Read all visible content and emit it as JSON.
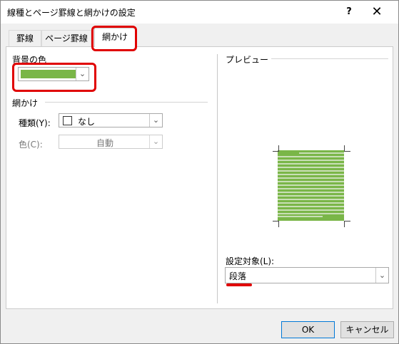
{
  "window": {
    "title": "線種とページ罫線と網かけの設定",
    "help_label": "?",
    "close_label": "✕"
  },
  "tabs": [
    {
      "label": "罫線"
    },
    {
      "label": "ページ罫線"
    },
    {
      "label": "網かけ",
      "active": true
    }
  ],
  "background": {
    "label": "背景の色",
    "selected_color": "#7ab648"
  },
  "shading": {
    "group_label": "網かけ",
    "style_label": "種類(Y):",
    "style_value": "なし",
    "color_label": "色(C):",
    "color_value": "自動"
  },
  "preview": {
    "label": "プレビュー",
    "fill_color": "#7ab648",
    "text_line_color": "#c9dfb6"
  },
  "apply_to": {
    "label": "設定対象(L):",
    "value": "段落"
  },
  "buttons": {
    "ok": "OK",
    "cancel": "キャンセル"
  },
  "annotation_color": "#e00000",
  "icons": {
    "dropdown": "chevron-down-icon",
    "help": "help-icon",
    "close": "close-icon"
  }
}
